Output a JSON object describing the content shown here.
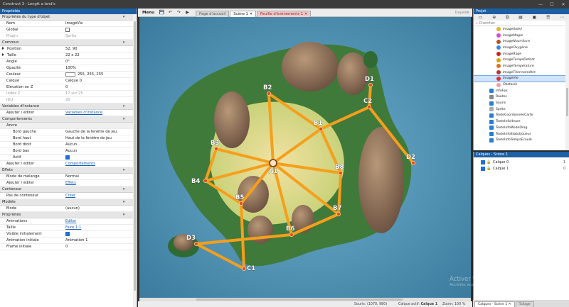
{
  "window": {
    "title": "Construct 3 - Lengtt a land's"
  },
  "properties_panel": {
    "title": "Propriétés",
    "rows": [
      {
        "type": "sect",
        "key": "Propriétés du type d'objet"
      },
      {
        "type": "text",
        "key": "Nom",
        "value": "ImageVie"
      },
      {
        "type": "check",
        "key": "Global",
        "checked": false
      },
      {
        "type": "text",
        "key": "Plugin",
        "value": "Sprite",
        "gray": true
      },
      {
        "type": "sect",
        "key": "Commun"
      },
      {
        "type": "expand",
        "key": "Position",
        "value": "52, 90"
      },
      {
        "type": "expand",
        "key": "Taille",
        "value": "22 x 22"
      },
      {
        "type": "text",
        "key": "Angle",
        "value": "0°"
      },
      {
        "type": "text",
        "key": "Opacité",
        "value": "100%"
      },
      {
        "type": "color",
        "key": "Couleur",
        "value": "255, 255, 255"
      },
      {
        "type": "select",
        "key": "Calque",
        "value": "Calque 0"
      },
      {
        "type": "text",
        "key": "Élévation en Z",
        "value": "0"
      },
      {
        "type": "text",
        "key": "Index Z",
        "value": "17 sur 25",
        "gray": true
      },
      {
        "type": "text",
        "key": "IDU",
        "value": "20",
        "gray": true
      },
      {
        "type": "sect",
        "key": "Variables d'instance"
      },
      {
        "type": "link",
        "key": "Ajouter / éditer",
        "value": "Variables d'instance"
      },
      {
        "type": "sect",
        "key": "Comportements"
      },
      {
        "type": "sub",
        "key": "Ancre"
      },
      {
        "type": "select",
        "key": "Bord gauche",
        "value": "Gauche de la fenêtre de jeu",
        "indent": true
      },
      {
        "type": "select",
        "key": "Bord haut",
        "value": "Haut de la fenêtre de jeu",
        "indent": true
      },
      {
        "type": "select",
        "key": "Bord droit",
        "value": "Aucun",
        "indent": true
      },
      {
        "type": "select",
        "key": "Bord bas",
        "value": "Aucun",
        "indent": true
      },
      {
        "type": "check",
        "key": "Actif",
        "checked": true,
        "indent": true
      },
      {
        "type": "link",
        "key": "Ajouter / éditer",
        "value": "Comportements"
      },
      {
        "type": "sect",
        "key": "Effets"
      },
      {
        "type": "select",
        "key": "Mode de mélange",
        "value": "Normal"
      },
      {
        "type": "link",
        "key": "Ajouter / éditer",
        "value": "Effets"
      },
      {
        "type": "sect",
        "key": "Conteneur"
      },
      {
        "type": "link",
        "key": "Pas de conteneur",
        "value": "Créer"
      },
      {
        "type": "sect",
        "key": "Modèle"
      },
      {
        "type": "select",
        "key": "Mode",
        "value": "(aucun)"
      },
      {
        "type": "sect",
        "key": "Propriétés"
      },
      {
        "type": "link",
        "key": "Animations",
        "value": "Éditer"
      },
      {
        "type": "link",
        "key": "Taille",
        "value": "Faire 1:1"
      },
      {
        "type": "check",
        "key": "Visible initialement",
        "checked": true
      },
      {
        "type": "select",
        "key": "Animation initiale",
        "value": "Animation 1"
      },
      {
        "type": "text",
        "key": "Frame initiale",
        "value": "0"
      }
    ]
  },
  "toolbar": {
    "menu_label": "Menu",
    "tabs": [
      {
        "label": "Page d'accueil",
        "kind": "normal"
      },
      {
        "label": "Scène 1 ✕",
        "kind": "active"
      },
      {
        "label": "Feuille d'événements 1 ✕",
        "kind": "ev"
      }
    ],
    "search_hint": "Dayvidé"
  },
  "map": {
    "node_color": "#f59f1c",
    "nodes": [
      {
        "id": "A1",
        "label": "A1"
      },
      {
        "id": "B1",
        "label": "B1"
      },
      {
        "id": "B2",
        "label": "B2"
      },
      {
        "id": "B3",
        "label": "B3"
      },
      {
        "id": "B4",
        "label": "B4"
      },
      {
        "id": "B5",
        "label": "B5"
      },
      {
        "id": "B6",
        "label": "B6"
      },
      {
        "id": "B7",
        "label": "B7"
      },
      {
        "id": "B8",
        "label": "B8"
      },
      {
        "id": "C1",
        "label": "C1"
      },
      {
        "id": "C2",
        "label": "C2"
      },
      {
        "id": "D1",
        "label": "D1"
      },
      {
        "id": "D2",
        "label": "D2"
      },
      {
        "id": "D3",
        "label": "D3"
      }
    ],
    "edges": [
      [
        "A1",
        "B1"
      ],
      [
        "A1",
        "B2"
      ],
      [
        "A1",
        "B3"
      ],
      [
        "A1",
        "B4"
      ],
      [
        "A1",
        "B5"
      ],
      [
        "A1",
        "B6"
      ],
      [
        "A1",
        "B7"
      ],
      [
        "A1",
        "B8"
      ],
      [
        "B2",
        "B1"
      ],
      [
        "B1",
        "C2"
      ],
      [
        "C2",
        "D1"
      ],
      [
        "C2",
        "D2"
      ],
      [
        "B1",
        "B8"
      ],
      [
        "B8",
        "B7"
      ],
      [
        "B7",
        "B6"
      ],
      [
        "B3",
        "B4"
      ],
      [
        "B4",
        "B5"
      ],
      [
        "B5",
        "C1"
      ],
      [
        "C1",
        "D3"
      ],
      [
        "D3",
        "B6"
      ]
    ]
  },
  "status": {
    "souris": "Souris: (1070, 980)",
    "calque_label": "Calque actif:",
    "calque": "Calque 1",
    "zoom": "Zoom: 100 %"
  },
  "project_panel": {
    "title": "Projet",
    "search_placeholder": "Chercher",
    "items": [
      {
        "label": "ImageSoleil",
        "color": "#f0b020",
        "indent": 2
      },
      {
        "label": "ImageMagie",
        "color": "#d24ad8",
        "indent": 2
      },
      {
        "label": "ImageNourriture",
        "color": "#c05020",
        "indent": 2
      },
      {
        "label": "ImageOxygène",
        "color": "#3a8ae0",
        "indent": 2
      },
      {
        "label": "ImageRage",
        "color": "#d02020",
        "indent": 2
      },
      {
        "label": "ImageTempsDefeat",
        "color": "#e0a000",
        "indent": 2
      },
      {
        "label": "ImageTempérature",
        "color": "#e07020",
        "indent": 2
      },
      {
        "label": "ImageThermomètre",
        "color": "#c03030",
        "indent": 2
      },
      {
        "label": "ImageVie",
        "color": "#e03030",
        "indent": 2,
        "selected": true
      },
      {
        "label": "Obstacle",
        "color": "#f0a0a0",
        "indent": 2
      },
      {
        "label": "InfoFps",
        "color": "#2a7fd0",
        "indent": 1
      },
      {
        "label": "Routes",
        "color": "#888888",
        "indent": 1
      },
      {
        "label": "Souris",
        "color": "#2a7fd0",
        "indent": 1
      },
      {
        "label": "Sprite",
        "color": "#aaaaaa",
        "indent": 1
      },
      {
        "label": "TexteCoordonnéeCarte",
        "color": "#2a7fd0",
        "indent": 1
      },
      {
        "label": "TexteInfoHeure",
        "color": "#2a7fd0",
        "indent": 1
      },
      {
        "label": "TexteInfoModeDrag",
        "color": "#2a7fd0",
        "indent": 1
      },
      {
        "label": "TexteInfoStatutJoueur",
        "color": "#2a7fd0",
        "indent": 1
      },
      {
        "label": "TexteInfoTempsEcoulé",
        "color": "#2a7fd0",
        "indent": 1
      }
    ]
  },
  "layers_panel": {
    "title": "Calques - Scène 1",
    "layers": [
      {
        "name": "Calque 0",
        "num": "1"
      },
      {
        "name": "Calque 1",
        "num": "0"
      }
    ]
  },
  "right_tabs": [
    {
      "label": "Calques - Scène 1 ✕"
    },
    {
      "label": "Tuilage"
    }
  ],
  "watermark": {
    "line1": "Activer Windows",
    "line2": "Accédez aux paramètres pour activer Windows"
  }
}
